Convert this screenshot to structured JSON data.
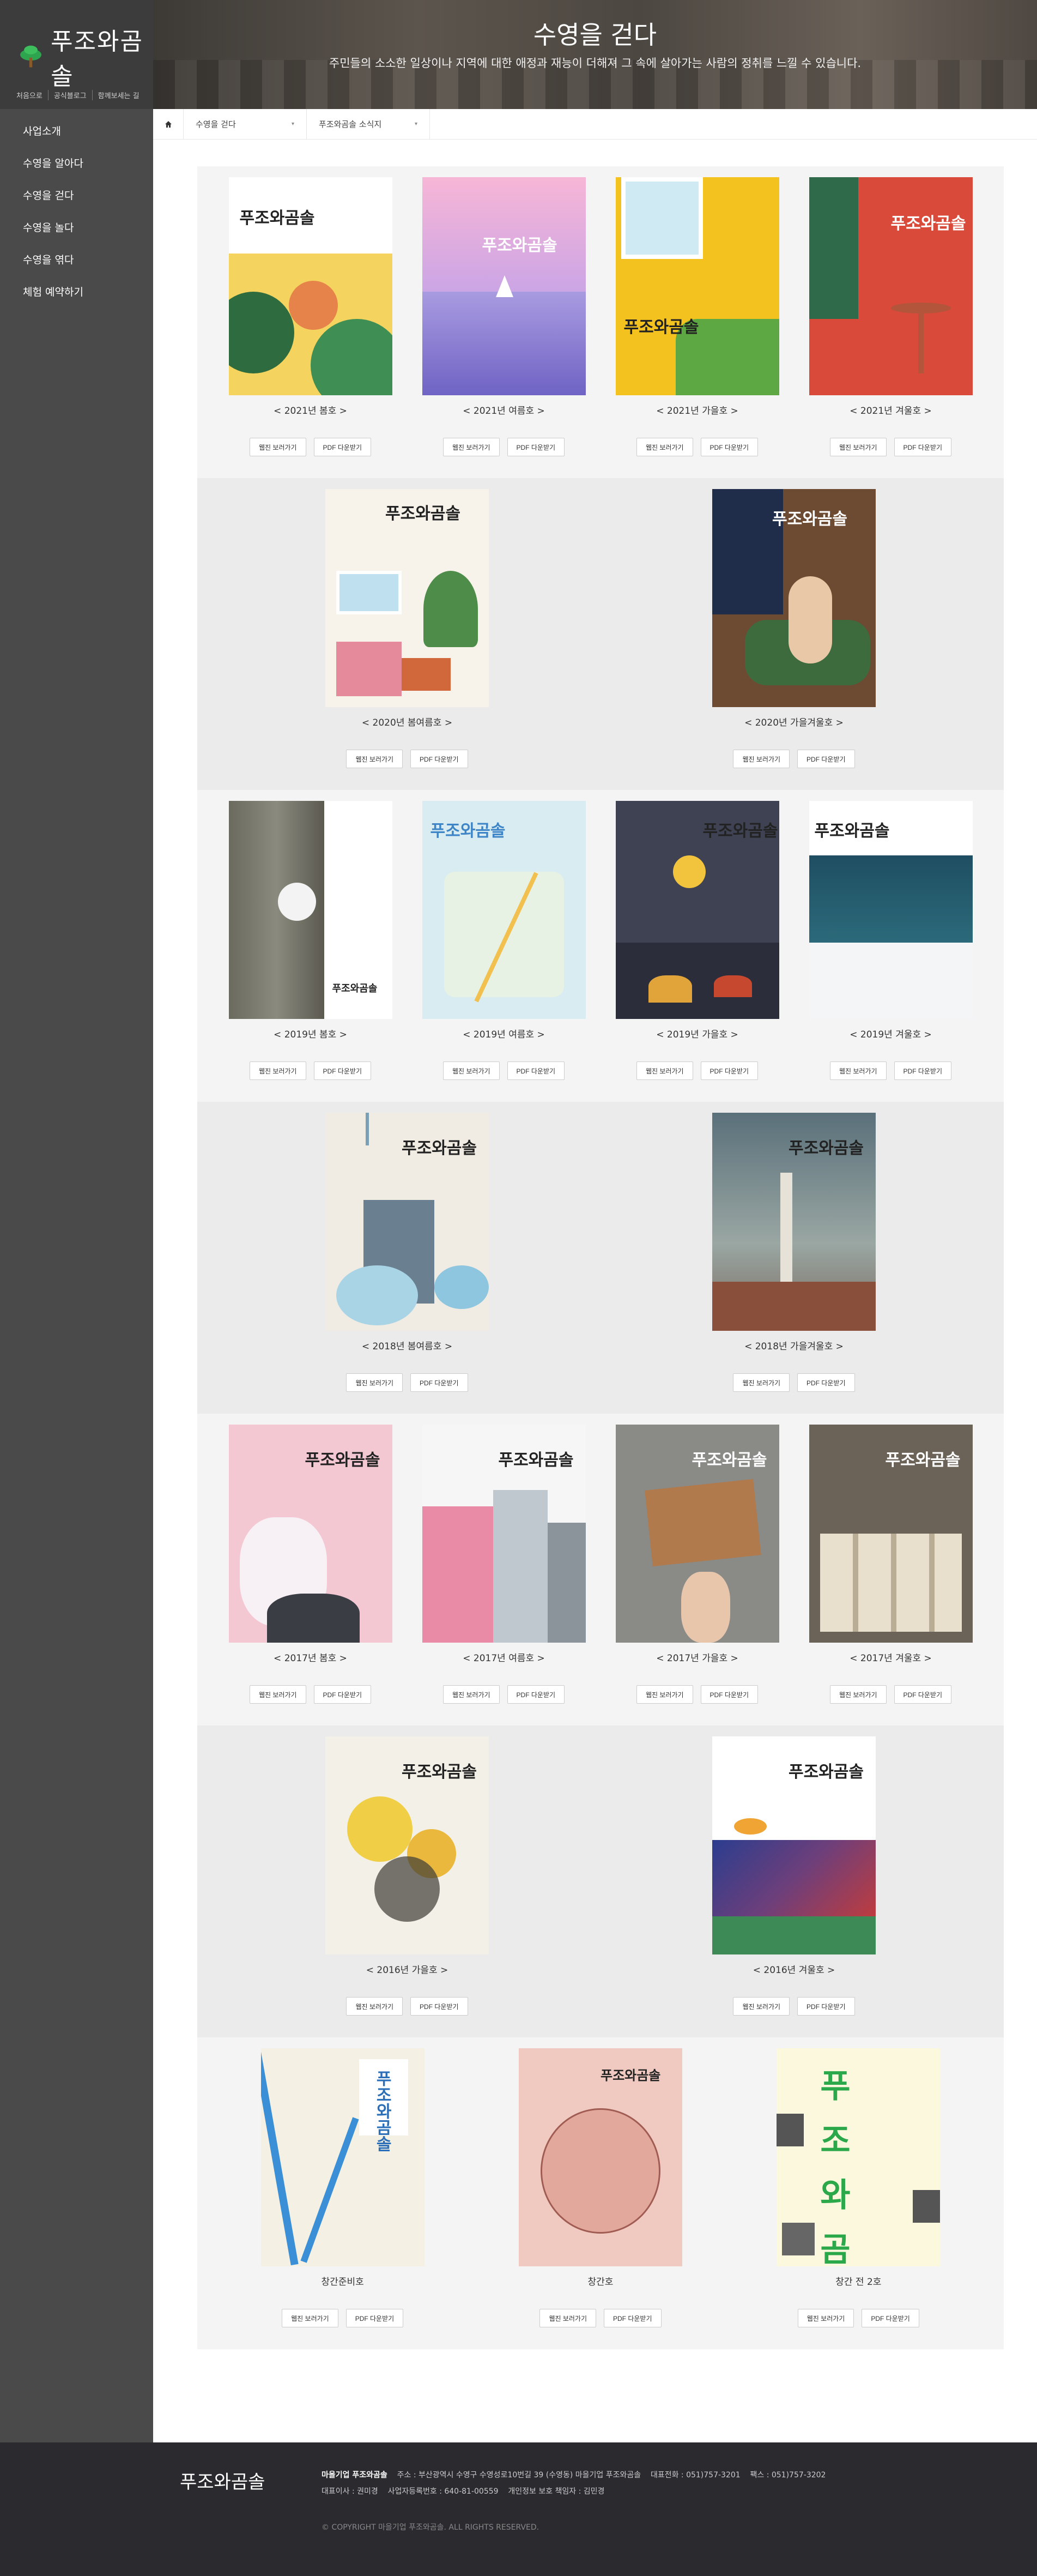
{
  "sidebar": {
    "logo_text": "푸조와곰솔",
    "top_links": [
      "처음으로",
      "공식블로그",
      "함께보세는 길"
    ],
    "menu": [
      "사업소개",
      "수영을 알아다",
      "수영을 걷다",
      "수영을 놀다",
      "수영을 엮다",
      "체험 예약하기"
    ]
  },
  "banner": {
    "title": "수영을 걷다",
    "subtitle": "주민들의 소소한 일상이나 지역에 대한 애정과 재능이 더해져 그 속에 살아가는 사람의 정취를 느낄 수 있습니다."
  },
  "breadcrumb": {
    "home_icon": "home-icon",
    "crumbs": [
      "수영을 걷다",
      "푸조와곰솔 소식지"
    ]
  },
  "buttons": {
    "view": "웹진 보러가기",
    "pdf": "PDF 다운받기"
  },
  "rows": [
    {
      "items": [
        {
          "caption": "< 2021년 봄호 >",
          "theme": "spring21"
        },
        {
          "caption": "< 2021년 여름호 >",
          "theme": "summer21"
        },
        {
          "caption": "< 2021년 가을호 >",
          "theme": "autumn21"
        },
        {
          "caption": "< 2021년 겨울호 >",
          "theme": "winter21"
        }
      ]
    },
    {
      "items": [
        {
          "caption": "< 2020년 봄여름호 >",
          "theme": "ss20"
        },
        {
          "caption": "< 2020년 가을겨울호 >",
          "theme": "aw20"
        }
      ]
    },
    {
      "items": [
        {
          "caption": "< 2019년 봄호 >",
          "theme": "spring19"
        },
        {
          "caption": "< 2019년 여름호 >",
          "theme": "summer19"
        },
        {
          "caption": "< 2019년 가을호 >",
          "theme": "autumn19"
        },
        {
          "caption": "< 2019년 겨울호 >",
          "theme": "winter19"
        }
      ]
    },
    {
      "items": [
        {
          "caption": "< 2018년 봄여름호 >",
          "theme": "ss18"
        },
        {
          "caption": "< 2018년 가을겨울호 >",
          "theme": "aw18"
        }
      ]
    },
    {
      "items": [
        {
          "caption": "< 2017년 봄호 >",
          "theme": "spring17"
        },
        {
          "caption": "< 2017년 여름호 >",
          "theme": "summer17"
        },
        {
          "caption": "< 2017년 가을호 >",
          "theme": "autumn17"
        },
        {
          "caption": "< 2017년 겨울호 >",
          "theme": "winter17"
        }
      ]
    },
    {
      "items": [
        {
          "caption": "< 2016년 가을호 >",
          "theme": "autumn16"
        },
        {
          "caption": "< 2016년 겨울호 >",
          "theme": "winter16"
        }
      ]
    },
    {
      "items": [
        {
          "caption": "창간준비호",
          "theme": "prep"
        },
        {
          "caption": "창간호",
          "theme": "first"
        },
        {
          "caption": "창간 전 2호",
          "theme": "pre2"
        }
      ]
    }
  ],
  "cover_brand": "푸조와곰솔",
  "footer": {
    "logo": "푸조와곰솔",
    "org": "마을기업 푸조와곰솔",
    "address": "주소 : 부산광역시 수영구 수영성로10번길 39 (수영동) 마을기업 푸조와곰솔",
    "phone": "대표전화 : 051)757-3201",
    "fax": "팩스 : 051)757-3202",
    "rep": "대표이사 : 권미경",
    "bizno": "사업자등록번호 : 640-81-00559",
    "privacy": "개인정보 보호 책임자 : 김민경",
    "copyright": "© COPYRIGHT 마을기업 푸조와곰솔. ALL RIGHTS RESERVED."
  }
}
